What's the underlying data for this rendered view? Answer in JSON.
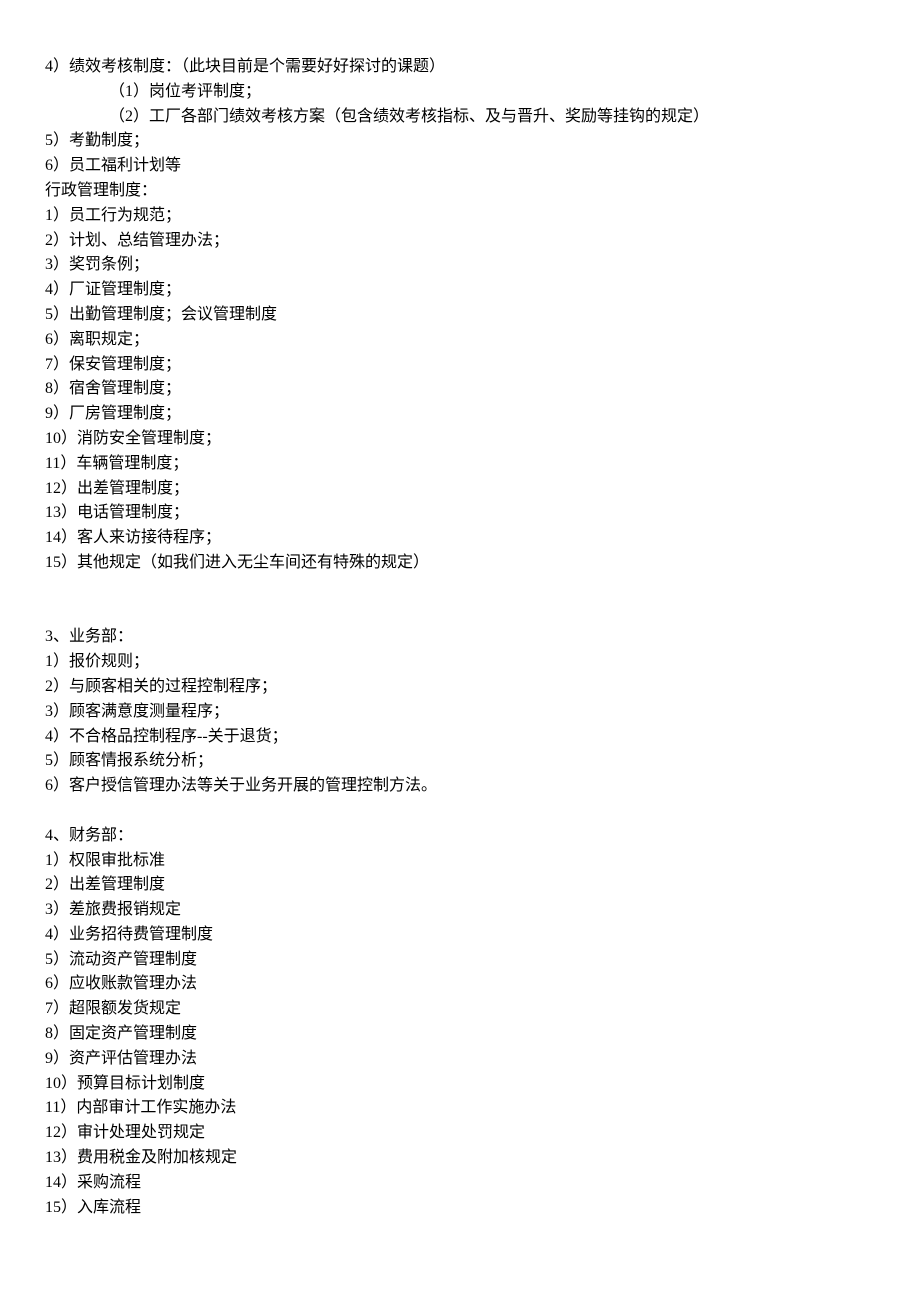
{
  "lines": [
    {
      "text": "4）绩效考核制度：（此块目前是个需要好好探讨的课题）",
      "indent": 0
    },
    {
      "text": "（1）岗位考评制度；",
      "indent": 1
    },
    {
      "text": "（2）工厂各部门绩效考核方案（包含绩效考核指标、及与晋升、奖励等挂钩的规定）",
      "indent": 1
    },
    {
      "text": "5）考勤制度；",
      "indent": 0
    },
    {
      "text": "6）员工福利计划等",
      "indent": 0
    },
    {
      "text": "行政管理制度：",
      "indent": 0
    },
    {
      "text": "1）员工行为规范；",
      "indent": 0
    },
    {
      "text": "2）计划、总结管理办法；",
      "indent": 0
    },
    {
      "text": "3）奖罚条例；",
      "indent": 0
    },
    {
      "text": "4）厂证管理制度；",
      "indent": 0
    },
    {
      "text": "5）出勤管理制度；会议管理制度",
      "indent": 0
    },
    {
      "text": "6）离职规定；",
      "indent": 0
    },
    {
      "text": "7）保安管理制度；",
      "indent": 0
    },
    {
      "text": "8）宿舍管理制度；",
      "indent": 0
    },
    {
      "text": "9）厂房管理制度；",
      "indent": 0
    },
    {
      "text": "10）消防安全管理制度；",
      "indent": 0
    },
    {
      "text": "11）车辆管理制度；",
      "indent": 0
    },
    {
      "text": "12）出差管理制度；",
      "indent": 0
    },
    {
      "text": "13）电话管理制度；",
      "indent": 0
    },
    {
      "text": "14）客人来访接待程序；",
      "indent": 0
    },
    {
      "text": "15）其他规定（如我们进入无尘车间还有特殊的规定）",
      "indent": 0
    },
    {
      "text": "",
      "spacer": true
    },
    {
      "text": "",
      "spacer": true
    },
    {
      "text": "3、业务部：",
      "indent": 0
    },
    {
      "text": "1）报价规则；",
      "indent": 0
    },
    {
      "text": "2）与顾客相关的过程控制程序；",
      "indent": 0
    },
    {
      "text": "3）顾客满意度测量程序；",
      "indent": 0
    },
    {
      "text": "4）不合格品控制程序--关于退货；",
      "indent": 0
    },
    {
      "text": "5）顾客情报系统分析；",
      "indent": 0
    },
    {
      "text": "6）客户授信管理办法等关于业务开展的管理控制方法。",
      "indent": 0
    },
    {
      "text": "",
      "spacer": true
    },
    {
      "text": "4、财务部：",
      "indent": 0
    },
    {
      "text": "1）权限审批标准",
      "indent": 0
    },
    {
      "text": "2）出差管理制度",
      "indent": 0
    },
    {
      "text": "3）差旅费报销规定",
      "indent": 0
    },
    {
      "text": "4）业务招待费管理制度",
      "indent": 0
    },
    {
      "text": "5）流动资产管理制度",
      "indent": 0
    },
    {
      "text": "6）应收账款管理办法",
      "indent": 0
    },
    {
      "text": "7）超限额发货规定",
      "indent": 0
    },
    {
      "text": "8）固定资产管理制度",
      "indent": 0
    },
    {
      "text": "9）资产评估管理办法",
      "indent": 0
    },
    {
      "text": "10）预算目标计划制度",
      "indent": 0
    },
    {
      "text": "11）内部审计工作实施办法",
      "indent": 0
    },
    {
      "text": "12）审计处理处罚规定",
      "indent": 0
    },
    {
      "text": "13）费用税金及附加核规定",
      "indent": 0
    },
    {
      "text": "14）采购流程",
      "indent": 0
    },
    {
      "text": "15）入库流程",
      "indent": 0
    }
  ]
}
